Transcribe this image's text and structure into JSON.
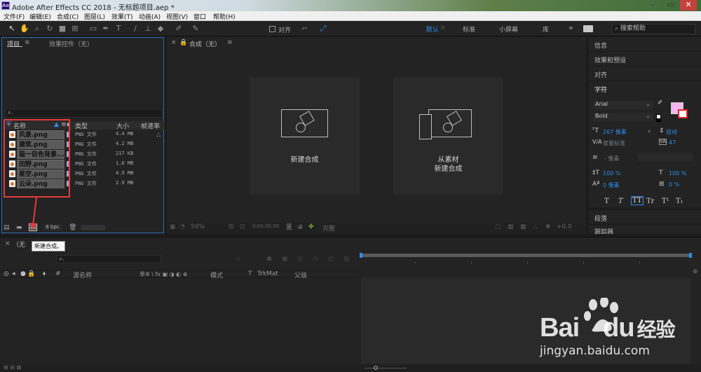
{
  "window": {
    "title": "Adobe After Effects CC 2018 - 无标题项目.aep *",
    "logo": "Ae"
  },
  "menu": [
    "文件(F)",
    "编辑(E)",
    "合成(C)",
    "图层(L)",
    "效果(T)",
    "动画(A)",
    "视图(V)",
    "窗口",
    "帮助(H)"
  ],
  "toolbar": {
    "snap_label": "对齐",
    "workspaces": [
      "默认",
      "标准",
      "小屏幕",
      "库"
    ],
    "more": "»",
    "search_placeholder": "搜索帮助"
  },
  "project": {
    "tab_project": "项目",
    "tab_effects": "效果控件（无）",
    "columns": {
      "name": "名称",
      "type": "类型",
      "size": "大小",
      "framerate": "帧速率"
    },
    "items": [
      {
        "name": "风景.png",
        "type": "PNG 文件",
        "size": "4.4 MB"
      },
      {
        "name": "建筑.png",
        "type": "PNG 文件",
        "size": "4.2 MB"
      },
      {
        "name": "猫一目色背景....",
        "type": "PNG 文件",
        "size": "217 KB"
      },
      {
        "name": "田野.png",
        "type": "PNG 文件",
        "size": "1.6 MB"
      },
      {
        "name": "星空.png",
        "type": "PNG 文件",
        "size": "4.9 MB"
      },
      {
        "name": "云朵.png",
        "type": "PNG 文件",
        "size": "2.9 MB"
      }
    ],
    "bpc": "8 bpc"
  },
  "comp": {
    "tab": "合成（无）",
    "new_comp": "新建合成",
    "from_footage_line1": "从素材",
    "from_footage_line2": "新建合成",
    "zoom": "50%",
    "timecode": "0:00:00:00",
    "res": "完整",
    "offset": "+0.0"
  },
  "right": {
    "info": "信息",
    "effects_presets": "效果和预设",
    "align": "对齐",
    "character": "字符",
    "font": "Arial",
    "style": "Bold",
    "font_size": "267 像素",
    "leading": "自动",
    "kerning": "度量标准",
    "tracking": "47",
    "stroke_width": "- 像素",
    "vscale": "100 %",
    "hscale": "100 %",
    "baseline": "0 像素",
    "tsume": "0 %",
    "text_styles": [
      "T",
      "T",
      "TT",
      "Tr",
      "T¹",
      "T₁"
    ],
    "paragraph": "段落",
    "tracker": "跟踪器",
    "fill_color": "#f2b6f0"
  },
  "timeline": {
    "tab": "（无",
    "tooltip": "新建合成。",
    "columns": {
      "num": "#",
      "source": "源名称",
      "switches": "单✲ \\ fx ▣ ◑ ◐ ⊕",
      "mode": "模式",
      "t": "T",
      "trkmat": "TrkMat",
      "parent": "父级"
    }
  },
  "watermark": {
    "brand_a": "Bai",
    "brand_b": "du",
    "brand_c": "经验",
    "url": "jingyan.baidu.com"
  }
}
